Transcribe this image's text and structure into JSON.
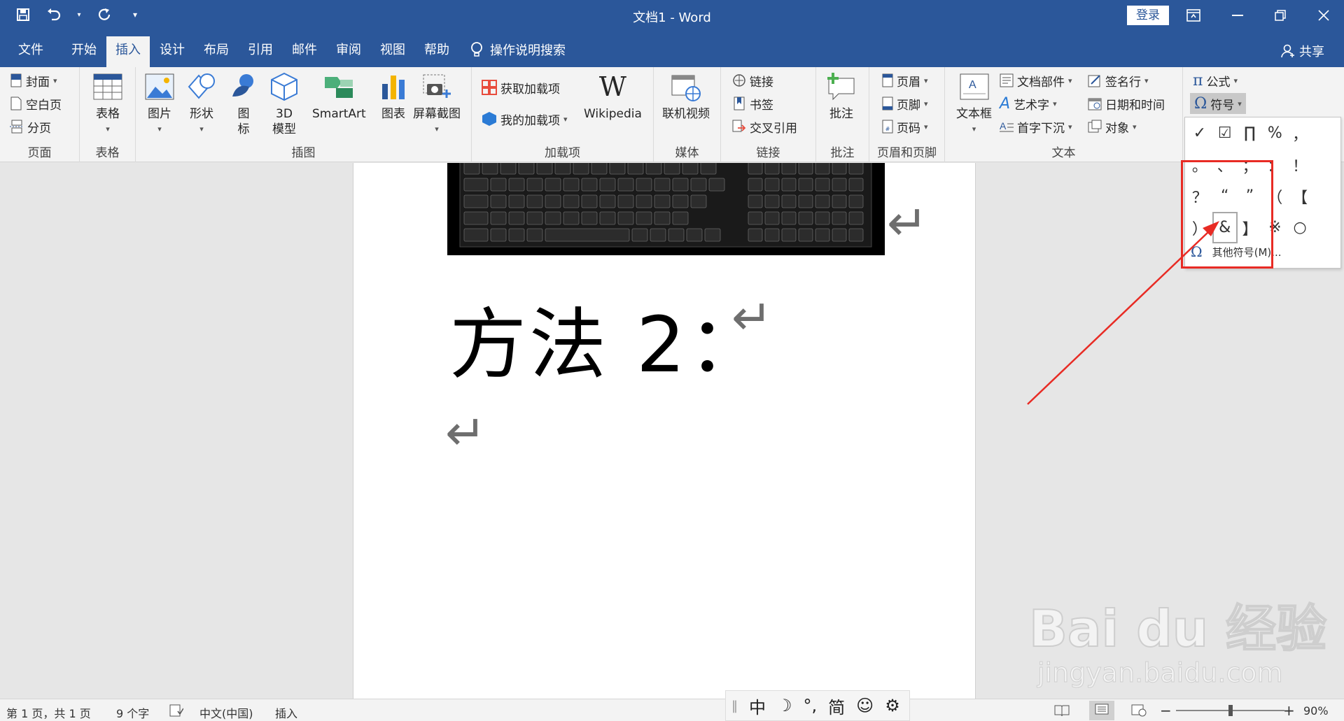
{
  "window": {
    "title": "文档1  -  Word",
    "login_label": "登录"
  },
  "quick_access": {
    "save_icon": "save-icon",
    "undo_icon": "undo-icon",
    "redo_icon": "redo-icon",
    "customize_icon": "customize-qat-icon"
  },
  "tabs": [
    {
      "label": "文件"
    },
    {
      "label": "开始"
    },
    {
      "label": "插入",
      "active": true
    },
    {
      "label": "设计"
    },
    {
      "label": "布局"
    },
    {
      "label": "引用"
    },
    {
      "label": "邮件"
    },
    {
      "label": "审阅"
    },
    {
      "label": "视图"
    },
    {
      "label": "帮助"
    }
  ],
  "tell_me": "操作说明搜索",
  "share_label": "共享",
  "ribbon": {
    "pages": {
      "label": "页面",
      "cover": "封面",
      "blank": "空白页",
      "break": "分页"
    },
    "tables": {
      "label": "表格",
      "table": "表格"
    },
    "illustrations": {
      "label": "插图",
      "picture": "图片",
      "shapes": "形状",
      "icons": "图\n标",
      "model3d": "3D\n模型",
      "smartart": "SmartArt",
      "chart": "图表",
      "screenshot": "屏幕截图"
    },
    "addins": {
      "label": "加载项",
      "get": "获取加载项",
      "my": "我的加载项",
      "wikipedia": "Wikipedia"
    },
    "media": {
      "label": "媒体",
      "video": "联机视频"
    },
    "links": {
      "label": "链接",
      "link": "链接",
      "bookmark": "书签",
      "crossref": "交叉引用"
    },
    "comments": {
      "label": "批注",
      "comment": "批注"
    },
    "header_footer": {
      "label": "页眉和页脚",
      "header": "页眉",
      "footer": "页脚",
      "page_number": "页码"
    },
    "text": {
      "label": "文本",
      "textbox": "文本框",
      "quickparts": "文档部件",
      "wordart": "艺术字",
      "dropcap": "首字下沉",
      "signature": "签名行",
      "datetime": "日期和时间",
      "object": "对象"
    },
    "symbols": {
      "equation": "公式",
      "symbol": "符号"
    }
  },
  "document": {
    "heading": "方法 2：",
    "para_mark": "↵"
  },
  "symbol_menu": {
    "rows": [
      [
        "✓",
        "☑",
        "∏",
        "%",
        "，",
        ""
      ],
      [
        "。",
        "、",
        "；",
        "：",
        "！",
        ""
      ],
      [
        "？",
        "“",
        "”",
        "（",
        "【",
        ""
      ],
      [
        "）",
        "&",
        "】",
        "※",
        "○",
        ""
      ]
    ],
    "selected_symbol": "&",
    "more_label": "其他符号(M)..."
  },
  "watermark": {
    "brand": "Bai  du 经验",
    "url": "jingyan.baidu.com"
  },
  "status": {
    "page": "第 1 页，共 1 页",
    "words": "9 个字",
    "language": "中文(中国)",
    "mode": "插入",
    "zoom": "90%",
    "zoom_fraction": 0.5
  },
  "ime": {
    "lang": "中",
    "moon": "☽",
    "punct": "°,",
    "simplified": "简",
    "emoji": "☺",
    "settings": "⚙"
  },
  "colors": {
    "accent": "#2b579a",
    "highlight": "#e82b24"
  }
}
